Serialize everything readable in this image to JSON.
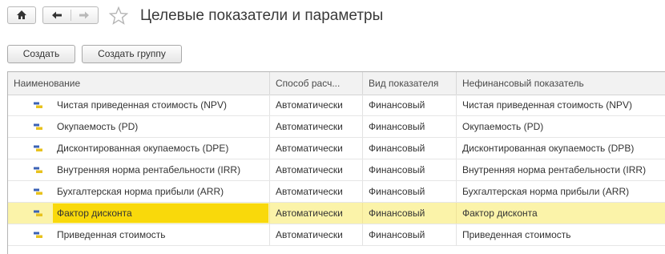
{
  "window": {
    "title": "Целевые показатели и параметры"
  },
  "toolbar": {
    "create_label": "Создать",
    "create_group_label": "Создать группу"
  },
  "table": {
    "columns": [
      "Наименование",
      "Способ расч...",
      "Вид показателя",
      "Нефинансовый показатель"
    ],
    "rows": [
      {
        "name": "Чистая приведенная стоимость (NPV)",
        "method": "Автоматически",
        "type": "Финансовый",
        "nonfin": "Чистая приведенная стоимость (NPV)",
        "selected": false
      },
      {
        "name": "Окупаемость (PD)",
        "method": "Автоматически",
        "type": "Финансовый",
        "nonfin": "Окупаемость (PD)",
        "selected": false
      },
      {
        "name": "Дисконтированная окупаемость (DPE)",
        "method": "Автоматически",
        "type": "Финансовый",
        "nonfin": "Дисконтированная окупаемость (DPB)",
        "selected": false
      },
      {
        "name": "Внутренняя норма рентабельности (IRR)",
        "method": "Автоматически",
        "type": "Финансовый",
        "nonfin": "Внутренняя норма рентабельности (IRR)",
        "selected": false
      },
      {
        "name": "Бухгалтерская норма прибыли (ARR)",
        "method": "Автоматически",
        "type": "Финансовый",
        "nonfin": "Бухгалтерская норма прибыли (ARR)",
        "selected": false
      },
      {
        "name": "Фактор дисконта",
        "method": "Автоматически",
        "type": "Финансовый",
        "nonfin": "Фактор дисконта",
        "selected": true
      },
      {
        "name": "Приведенная стоимость",
        "method": "Автоматически",
        "type": "Финансовый",
        "nonfin": "Приведенная стоимость",
        "selected": false
      }
    ]
  },
  "colors": {
    "selected_row": "#fbf3a9",
    "selected_cell": "#f9d90b",
    "header_bg": "#f2f2f2"
  },
  "icons": {
    "home": "home-icon",
    "back": "arrow-left-icon",
    "forward": "arrow-right-icon",
    "favorite": "star-icon",
    "row": "catalog-item-icon"
  }
}
